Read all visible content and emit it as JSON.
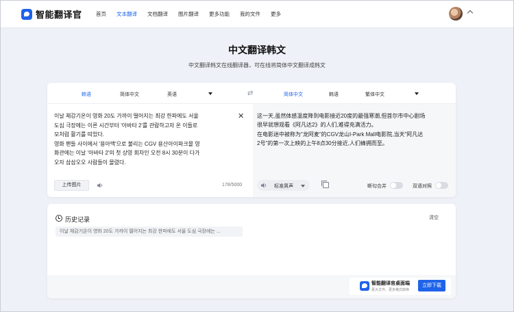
{
  "nav": {
    "logo_text": "智能翻译官",
    "items": [
      "首页",
      "文本翻译",
      "文档翻译",
      "图片翻译",
      "更多功能",
      "我的文件",
      "更多"
    ],
    "active_index": 1
  },
  "header": {
    "title": "中文翻译韩文",
    "subtitle": "中文翻译韩文在线翻译器，可在线将简体中文翻译成韩文"
  },
  "translator": {
    "source_langs": [
      "韩语",
      "简体中文",
      "英语"
    ],
    "target_langs": [
      "简体中文",
      "韩语",
      "繁体中文"
    ],
    "source_text_lines": [
      "이날 체감기온이 영화 20도 가까이 떨어지는 최강 한파에도 서울",
      "도심 극장에는 이른 시간부터 '아바타 2'를 관람하고자 온 이들로",
      "모처럼 활기를 띠었다.",
      "영화 팬들 사이에서 '용아맥'으로 불리는 CGV 용산아이파크몰 영",
      "화관에는 이날 '아바타 2'의 첫 상영 회차인 오전 8시 30분이 다가",
      "오자 삼삼오오 사람들이 몰렸다."
    ],
    "target_text_lines": [
      "这一天,虽然体感温度降到电影接近20度的最强寒潮,但首尔市中心剧场",
      "很早就想观看《阿凡达2》的人们,难得充满活力。",
      "在电影迷中被称为\"龙阿麦\"的CGV龙山I-Park Mall电影院,当天\"阿凡达",
      "2号\"的第一次上映的上午8点30分接近,人们蜂拥而至。"
    ],
    "upload_label": "上传图片",
    "char_count": "178/5000",
    "voice_label": "标准男声",
    "option_sentence_merge": "断句合并",
    "option_bilingual": "双语对照"
  },
  "history": {
    "title": "历史记录",
    "clear_label": "清空",
    "items": [
      "이날 체감기온이 영화 20도 가까이 떨어지는 최강 한파에도 서울 도심 극장에는 ..."
    ]
  },
  "download": {
    "title": "智能翻译官桌面端",
    "subtitle": "更大文件、更多格式转换",
    "button": "立即下载"
  },
  "colors": {
    "accent": "#1e63e9",
    "page_bg": "#eef1f7"
  }
}
